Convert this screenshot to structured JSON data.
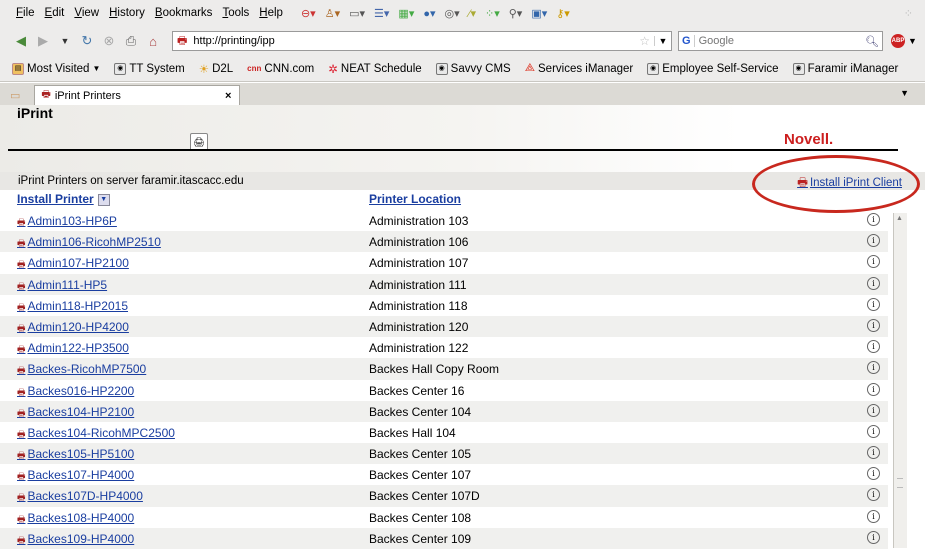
{
  "menu": [
    "File",
    "Edit",
    "View",
    "History",
    "Bookmarks",
    "Tools",
    "Help"
  ],
  "toolbar_icons": [
    "stop-icon",
    "person-icon",
    "mail-icon",
    "list-icon",
    "sheet-icon",
    "globe-icon",
    "cd-icon",
    "brush-icon",
    "grid-icon",
    "tools-icon",
    "screen-icon",
    "key-icon"
  ],
  "nav": {
    "url": "http://printing/ipp",
    "search_placeholder": "Google",
    "search_engine": "G"
  },
  "bookmarks": [
    "Most Visited",
    "TT System",
    "D2L",
    "CNN.com",
    "NEAT Schedule",
    "Savvy CMS",
    "Services iManager",
    "Employee Self-Service",
    "Faramir iManager"
  ],
  "tab": {
    "title": "iPrint Printers"
  },
  "page": {
    "app_title": "iPrint",
    "brand": "Novell.",
    "server_text": "iPrint Printers on server faramir.itascacc.edu",
    "install_client": "Install iPrint Client",
    "col_printer": "Install Printer",
    "col_location": "Printer Location"
  },
  "printers": [
    {
      "name": "Admin103-HP6P",
      "location": "Administration 103"
    },
    {
      "name": "Admin106-RicohMP2510",
      "location": "Administration 106"
    },
    {
      "name": "Admin107-HP2100",
      "location": "Administration 107"
    },
    {
      "name": "Admin111-HP5",
      "location": "Administration 111"
    },
    {
      "name": "Admin118-HP2015",
      "location": "Administration 118"
    },
    {
      "name": "Admin120-HP4200",
      "location": "Administration 120"
    },
    {
      "name": "Admin122-HP3500",
      "location": "Administration 122"
    },
    {
      "name": "Backes-RicohMP7500",
      "location": "Backes Hall Copy Room"
    },
    {
      "name": "Backes016-HP2200",
      "location": "Backes Center 16"
    },
    {
      "name": "Backes104-HP2100",
      "location": "Backes Center 104"
    },
    {
      "name": "Backes104-RicohMPC2500",
      "location": "Backes Hall 104"
    },
    {
      "name": "Backes105-HP5100",
      "location": "Backes Center 105"
    },
    {
      "name": "Backes107-HP4000",
      "location": "Backes Center 107"
    },
    {
      "name": "Backes107D-HP4000",
      "location": "Backes Center 107D"
    },
    {
      "name": "Backes108-HP4000",
      "location": "Backes Center 108"
    },
    {
      "name": "Backes109-HP4000",
      "location": "Backes Center 109"
    }
  ],
  "colors": {
    "link": "#1a3ea0",
    "novell_red": "#cc1e1e",
    "annotation": "#c8281e"
  }
}
